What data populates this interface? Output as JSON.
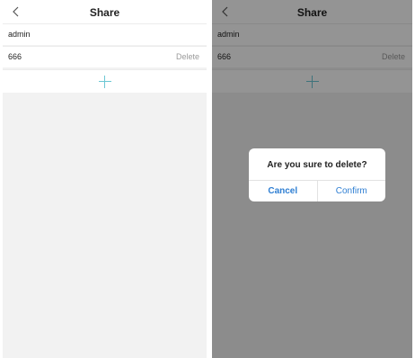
{
  "screens": [
    {
      "title": "Share",
      "back_icon": "chevron-left-icon",
      "items": [
        {
          "label": "admin"
        },
        {
          "label": "666",
          "action": "Delete"
        }
      ],
      "add_icon": "plus-icon"
    },
    {
      "title": "Share",
      "back_icon": "chevron-left-icon",
      "items": [
        {
          "label": "admin"
        },
        {
          "label": "666",
          "action": "Delete"
        }
      ],
      "add_icon": "plus-icon",
      "dialog": {
        "message": "Are you sure to delete?",
        "cancel": "Cancel",
        "confirm": "Confirm"
      }
    }
  ],
  "colors": {
    "accent": "#2f7fd3",
    "plus": "#6cc7d4",
    "muted": "#9a9a9a"
  }
}
